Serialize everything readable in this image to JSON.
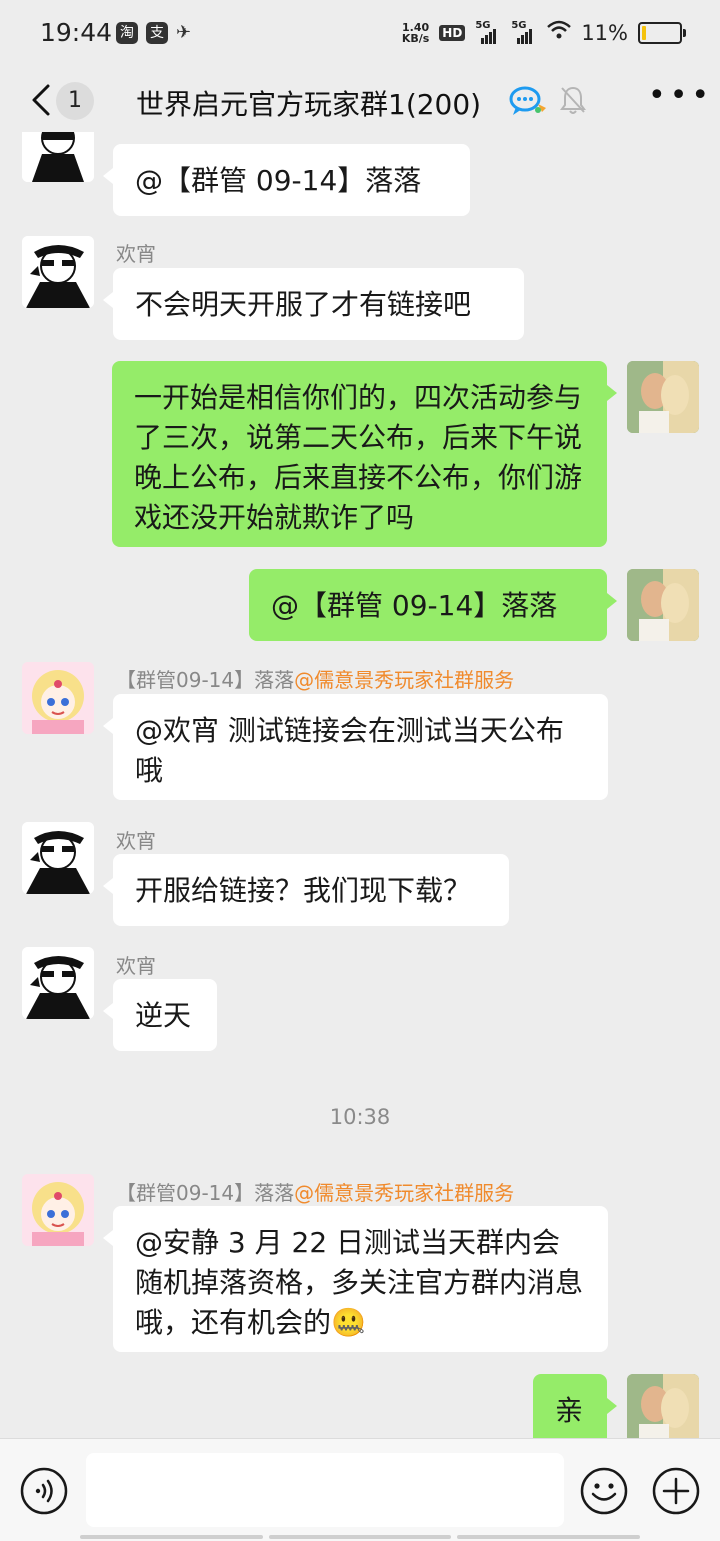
{
  "status_bar": {
    "time": "19:44",
    "app_icons": [
      "淘",
      "支"
    ],
    "net_speed_value": "1.40",
    "net_speed_unit": "KB/s",
    "hd_label": "HD",
    "sim1_label": "5G",
    "sim2_label": "5G",
    "battery_percent": "11%",
    "battery_level": 0.11,
    "battery_color": "#f4c20d"
  },
  "header": {
    "unread_count": "1",
    "title": "世界启元官方玩家群1(200)"
  },
  "messages": [
    {
      "text": "@【群管 09-14】落落"
    },
    {
      "sender": "欢宵",
      "text": "不会明天开服了才有链接吧"
    },
    {
      "text": "一开始是相信你们的，四次活动参与了三次，说第二天公布，后来下午说晚上公布，后来直接不公布，你们游戏还没开始就欺诈了吗"
    },
    {
      "text": "@【群管 09-14】落落"
    },
    {
      "sender_role": "【群管09-14】落落",
      "sender_org": "@儒意景秀玩家社群服务",
      "text": "@欢宵 测试链接会在测试当天公布哦"
    },
    {
      "sender": "欢宵",
      "text": "开服给链接？我们现下载？"
    },
    {
      "sender": "欢宵",
      "text": "逆天"
    },
    {
      "sender_role": "【群管09-14】落落",
      "sender_org": "@儒意景秀玩家社群服务",
      "text": "@安静 3 月 22 日测试当天群内会随机掉落资格，多关注官方群内消息哦，还有机会的🤐"
    },
    {
      "text": "亲"
    }
  ],
  "timestamp": "10:38",
  "colors": {
    "background": "#ededed",
    "bubble_incoming": "#ffffff",
    "bubble_outgoing": "#95ec69",
    "org_label": "#f08a2c"
  },
  "icons": [
    "back-chevron-icon",
    "qq-chat-icon",
    "mute-bell-icon",
    "more-dots-icon",
    "voice-icon",
    "emoji-icon",
    "plus-icon"
  ]
}
